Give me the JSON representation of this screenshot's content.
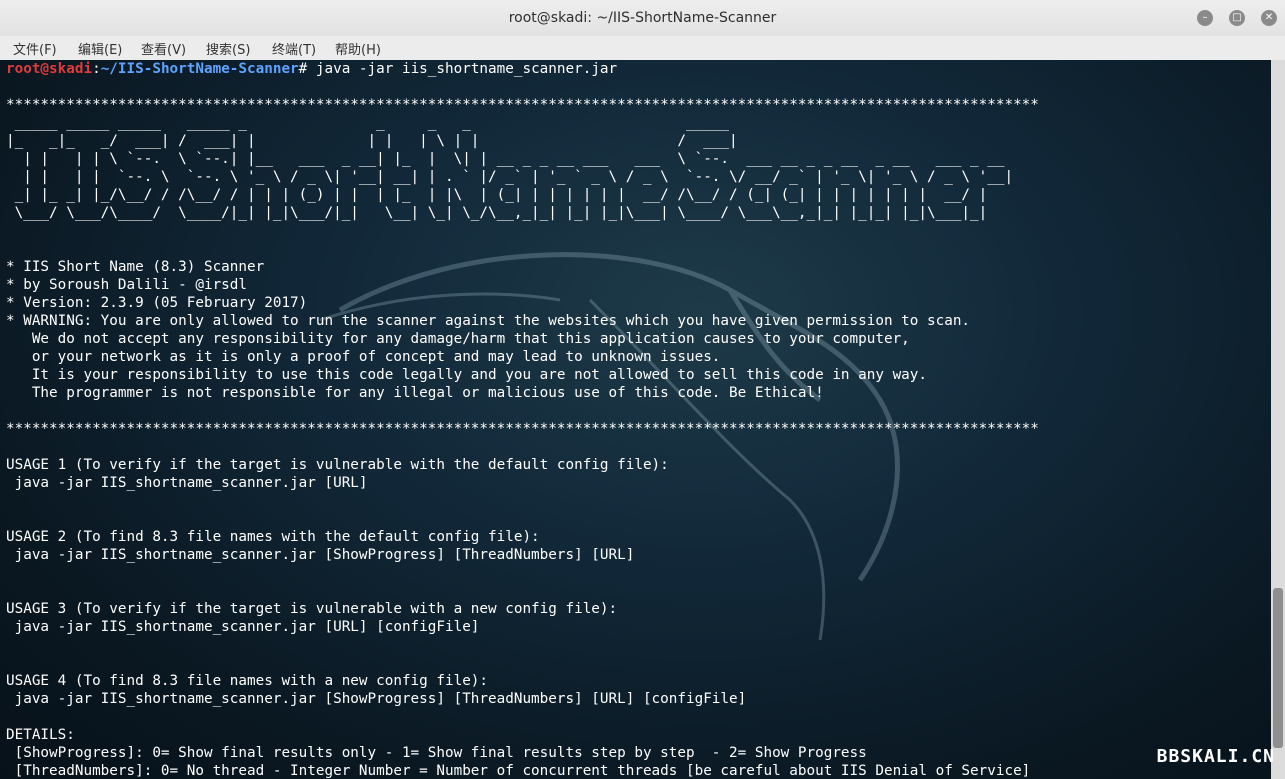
{
  "window": {
    "title": "root@skadi: ~/IIS-ShortName-Scanner"
  },
  "menu": [
    "文件(F)",
    "编辑(E)",
    "查看(V)",
    "搜索(S)",
    "终端(T)",
    "帮助(H)"
  ],
  "prompt": {
    "user": "root@skadi",
    "sep": ":",
    "path": "~/IIS-ShortName-Scanner",
    "symbol": "# ",
    "command": "java -jar iis_shortname_scanner.jar"
  },
  "output": {
    "stars": "************************************************************************************************************************",
    "banner": [
      " _____ _____ _____   _____ _               _     _   _                         _____                                 ",
      "|_   _|_   _/  ___| /  ___| |             | |   | \\ | |                       /  ___|                                ",
      "  | |   | | \\ `--.  \\ `--.| |__   ___  _ __| |_  |  \\| | __ _ _ __ ___   ___  \\ `--.  ___ __ _ _ __  _ __   ___ _ __ ",
      "  | |   | |  `--. \\  `--. \\ '_ \\ / _ \\| '__| __| | . ` |/ _` | '_ ` _ \\ / _ \\  `--. \\/ __/ _` | '_ \\| '_ \\ / _ \\ '__|",
      " _| |_ _| |_/\\__/ / /\\__/ / | | | (_) | |  | |_  | |\\  | (_| | | | | | |  __/ /\\__/ / (_| (_| | | | | | | |  __/ |   ",
      " \\___/ \\___/\\____/  \\____/|_| |_|\\___/|_|   \\__| \\_| \\_/\\__,_|_| |_| |_|\\___| \\____/ \\___\\__,_|_| |_|_| |_|\\___|_|   "
    ],
    "info": [
      "* IIS Short Name (8.3) Scanner",
      "* by Soroush Dalili - @irsdl",
      "* Version: 2.3.9 (05 February 2017)",
      "* WARNING: You are only allowed to run the scanner against the websites which you have given permission to scan.",
      "   We do not accept any responsibility for any damage/harm that this application causes to your computer,",
      "   or your network as it is only a proof of concept and may lead to unknown issues.",
      "   It is your responsibility to use this code legally and you are not allowed to sell this code in any way.",
      "   The programmer is not responsible for any illegal or malicious use of this code. Be Ethical!"
    ],
    "usage1_title": "USAGE 1 (To verify if the target is vulnerable with the default config file):",
    "usage1_cmd": " java -jar IIS_shortname_scanner.jar [URL]",
    "usage2_title": "USAGE 2 (To find 8.3 file names with the default config file):",
    "usage2_cmd": " java -jar IIS_shortname_scanner.jar [ShowProgress] [ThreadNumbers] [URL]",
    "usage3_title": "USAGE 3 (To verify if the target is vulnerable with a new config file):",
    "usage3_cmd": " java -jar IIS_shortname_scanner.jar [URL] [configFile]",
    "usage4_title": "USAGE 4 (To find 8.3 file names with a new config file):",
    "usage4_cmd": " java -jar IIS_shortname_scanner.jar [ShowProgress] [ThreadNumbers] [URL] [configFile]",
    "details_title": "DETAILS:",
    "details": [
      " [ShowProgress]: 0= Show final results only - 1= Show final results step by step  - 2= Show Progress",
      " [ThreadNumbers]: 0= No thread - Integer Number = Number of concurrent threads [be careful about IIS Denial of Service]"
    ]
  },
  "watermark": "BBSKALI.CN",
  "colors": {
    "prompt_user": "#e23a3a",
    "prompt_path": "#5da3ff",
    "terminal_text": "#ffffff",
    "terminal_bg": "#0b1e27"
  }
}
